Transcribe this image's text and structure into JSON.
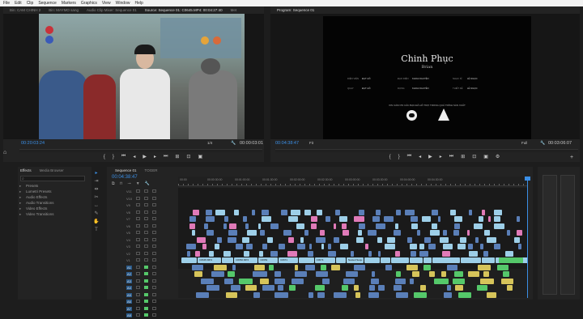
{
  "menu": [
    "File",
    "Edit",
    "Clip",
    "Sequence",
    "Markers",
    "Graphics",
    "View",
    "Window",
    "Help"
  ],
  "source_tabs": [
    {
      "label": "Bin: CAM CHINH 2",
      "active": false
    },
    {
      "label": "Bin: MAYMO sang",
      "active": false
    },
    {
      "label": "Audio Clip Mixer: Sequence 01",
      "active": false
    },
    {
      "label": "Source: Sequence 01: C0645.MP4: 00:04:27:40",
      "active": true
    },
    {
      "label": "Met",
      "active": false
    }
  ],
  "program_tab": "Program: Sequence 01",
  "source_monitor": {
    "timecode": "00:20:03:24",
    "fit": "1/4",
    "duration": "00:00:03:01"
  },
  "program_monitor": {
    "title": "Chinh Phục",
    "subtitle": "Brian",
    "credit_rows": [
      [
        "DIỄN VIÊN",
        "ĐẠT HỒ",
        "ĐẠO DIỄN",
        "KHOA NGUYỄN",
        "NHẠC SĨ",
        "LÊ NGỌC"
      ],
      [
        "QUAY",
        "ĐẠT HỒ",
        "DỰNG",
        "KHOA NGUYỄN",
        "THIẾT KẾ",
        "LÊ NGỌC"
      ]
    ],
    "thanks": "XIN CẢM ƠN CÁC BẠN ĐÃ HỖ TRỢ TRONG QUÁ TRÌNH SẢN XUẤT",
    "timecode": "00:04:38:47",
    "fit": "Fit",
    "quality": "Full",
    "duration": "00:03:06:07"
  },
  "effects_tabs": [
    {
      "label": "Effects",
      "active": true
    },
    {
      "label": "Media Browser",
      "active": false
    }
  ],
  "effects_items": [
    "Presets",
    "Lumetri Presets",
    "Audio Effects",
    "Audio Transitions",
    "Video Effects",
    "Video Transitions"
  ],
  "timeline": {
    "tabs": [
      {
        "label": "Sequence 01",
        "active": true
      },
      {
        "label": "TOGER",
        "active": false
      }
    ],
    "timecode": "00:04:38:47",
    "ruler_labels": [
      "00:00",
      "00:00:30:00",
      "00:01:00:00",
      "00:01:30:00",
      "00:02:00:00",
      "00:02:30:00",
      "00:03:00:00",
      "00:03:30:00",
      "00:04:00:00",
      "00:04:30:00"
    ],
    "video_tracks": [
      "V11",
      "V10",
      "V9",
      "V8",
      "V7",
      "V6",
      "V5",
      "V4",
      "V3",
      "V2",
      "V1"
    ],
    "audio_tracks": [
      "A1",
      "A2",
      "A3",
      "A4",
      "A5",
      "A6",
      "A7",
      "A8"
    ],
    "clip_labels": [
      "C0645.MP4",
      "C0652.MP4",
      "C0653",
      "C0671",
      "C0674",
      "Nested Sequ"
    ]
  },
  "colors": {
    "accent": "#3b8fe6",
    "video_clip": "#9dcfe8",
    "video_clip_dark": "#5a7fb8",
    "pink": "#e07ab8",
    "audio_clip": "#3ab888",
    "audio_green": "#55c86a",
    "yellow": "#d6c45a"
  },
  "icons": [
    "home-icon",
    "wrench-icon",
    "play-icon",
    "step-back-icon",
    "step-forward-icon",
    "camera-icon",
    "settings-icon",
    "plus-icon",
    "selection-tool-icon",
    "razor-tool-icon",
    "pen-tool-icon",
    "hand-tool-icon",
    "type-tool-icon"
  ]
}
